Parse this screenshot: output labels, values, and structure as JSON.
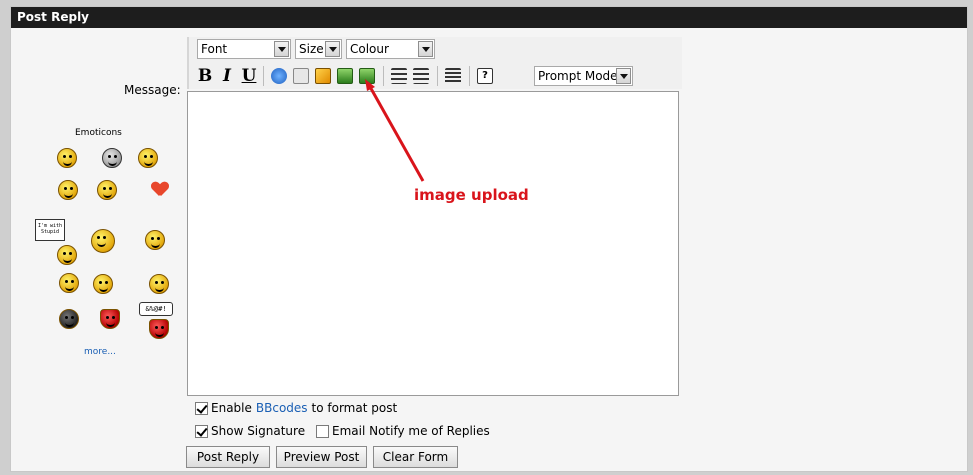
{
  "header": {
    "title": "Post Reply"
  },
  "message_label": "Message:",
  "toolbar": {
    "font_select": "Font",
    "size_select": "Size",
    "colour_select": "Colour",
    "bold": "B",
    "italic": "I",
    "underline": "U",
    "mode_select": "Prompt Mode"
  },
  "editor": {
    "value": ""
  },
  "annotation": {
    "text": "image upload",
    "color": "#d9141b"
  },
  "emoticons": {
    "title": "Emoticons",
    "sign_text": "I'm with Stupid",
    "bubble_text": "&%@#!",
    "more_label": "more..."
  },
  "options": {
    "enable_prefix": "Enable",
    "bbcodes_link": "BBcodes",
    "enable_suffix": "to format post",
    "enable_checked": true,
    "signature_label": "Show Signature",
    "signature_checked": true,
    "notify_label": "Email Notify me of Replies",
    "notify_checked": false
  },
  "buttons": {
    "post_reply": "Post Reply",
    "preview_post": "Preview Post",
    "clear_form": "Clear Form"
  },
  "colors": {
    "header_bg": "#1d1d1d",
    "link": "#1a5fb4"
  }
}
